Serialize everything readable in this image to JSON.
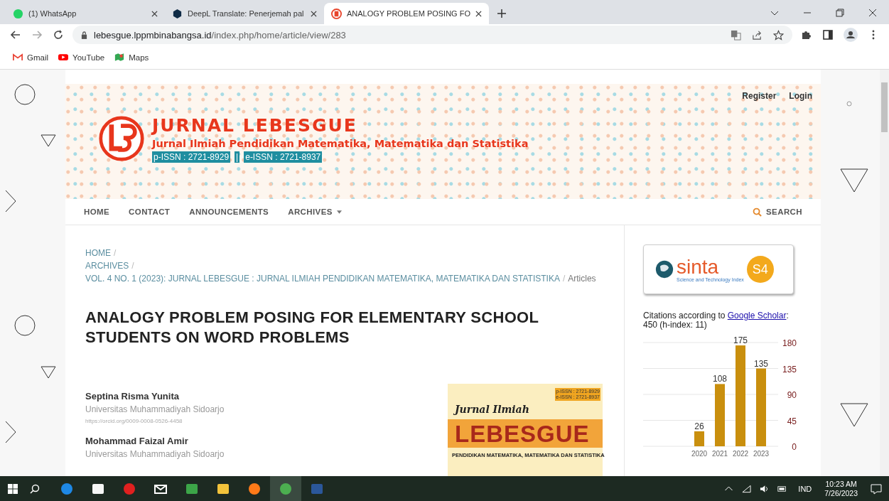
{
  "browser": {
    "tabs": [
      {
        "title": "(1) WhatsApp",
        "kind": "whatsapp",
        "selected": false
      },
      {
        "title": "DeepL Translate: Penerjemah pal",
        "kind": "deepl",
        "selected": false
      },
      {
        "title": "ANALOGY PROBLEM POSING FO",
        "kind": "journal",
        "selected": true
      }
    ],
    "url_host": "lebesgue.lppmbinabangsa.id",
    "url_path": "/index.php/home/article/view/283",
    "bookmarks": [
      {
        "label": "Gmail",
        "kind": "gmail"
      },
      {
        "label": "YouTube",
        "kind": "youtube"
      },
      {
        "label": "Maps",
        "kind": "maps"
      }
    ]
  },
  "site": {
    "header": {
      "title": "JURNAL LEBESGUE",
      "subtitle": "Jurnal Ilmiah Pendidikan Matematika, Matematika dan Statistika",
      "issn_print": "p-ISSN : 2721-8929",
      "issn_separator": "|",
      "issn_online": "e-ISSN : 2721-8937",
      "user_links": [
        "Register",
        "Login"
      ]
    },
    "nav": [
      {
        "label": "HOME",
        "dropdown": false
      },
      {
        "label": "CONTACT",
        "dropdown": false
      },
      {
        "label": "ANNOUNCEMENTS",
        "dropdown": false
      },
      {
        "label": "ARCHIVES",
        "dropdown": true
      }
    ],
    "search_label": "SEARCH",
    "breadcrumb": {
      "links": [
        "HOME",
        "ARCHIVES",
        "VOL. 4 NO. 1 (2023): JURNAL LEBESGUE : JURNAL ILMIAH PENDIDIKAN MATEMATIKA, MATEMATIKA DAN STATISTIKA"
      ],
      "separator": "/",
      "current": "Articles"
    },
    "article_title": "ANALOGY PROBLEM POSING FOR ELEMENTARY SCHOOL STUDENTS ON WORD PROBLEMS",
    "authors": [
      {
        "name": "Septina Risma Yunita",
        "affiliation": "Universitas Muhammadiyah Sidoarjo",
        "orcid": "https://orcid.org/0009-0008-0526-4458"
      },
      {
        "name": "Mohammad Faizal Amir",
        "affiliation": "Universitas Muhammadiyah Sidoarjo"
      }
    ],
    "cover": {
      "issn_print": "p-ISSN : 2721-8929",
      "issn_online": "e-ISSN : 2721-8937",
      "script": "Jurnal Ilmiah",
      "title": "LEBESGUE",
      "subtitle": "PENDIDIKAN MATEMATIKA, MATEMATIKA DAN STATISTIKA"
    },
    "sidebar": {
      "sinta": {
        "name": "sinta",
        "tagline": "Science and Technology Index",
        "rank": "S4"
      },
      "citations": {
        "prefix": "Citations according to ",
        "link": "Google Scholar",
        "suffix": ":",
        "line2": "450 (h-index: 11)"
      },
      "chart_data": {
        "type": "bar",
        "categories": [
          "2020",
          "2021",
          "2022",
          "2023"
        ],
        "series": [
          {
            "color": "#c98f0e",
            "values": [
              26,
              108,
              175,
              135
            ]
          }
        ],
        "ylim": [
          0,
          180
        ],
        "yticks": [
          0,
          45,
          90,
          135,
          180
        ],
        "grid": true,
        "data_labels": true
      }
    }
  },
  "taskbar": {
    "apps": [
      {
        "kind": "edge",
        "selected": false
      },
      {
        "kind": "store",
        "selected": false
      },
      {
        "kind": "opera",
        "selected": false
      },
      {
        "kind": "mail",
        "selected": false
      },
      {
        "kind": "sheet",
        "selected": false
      },
      {
        "kind": "files",
        "selected": false
      },
      {
        "kind": "firefox",
        "selected": false
      },
      {
        "kind": "chrome",
        "selected": true
      },
      {
        "kind": "word",
        "selected": false
      }
    ],
    "language": "IND",
    "time": "10:23 AM",
    "date": "7/26/2023"
  }
}
